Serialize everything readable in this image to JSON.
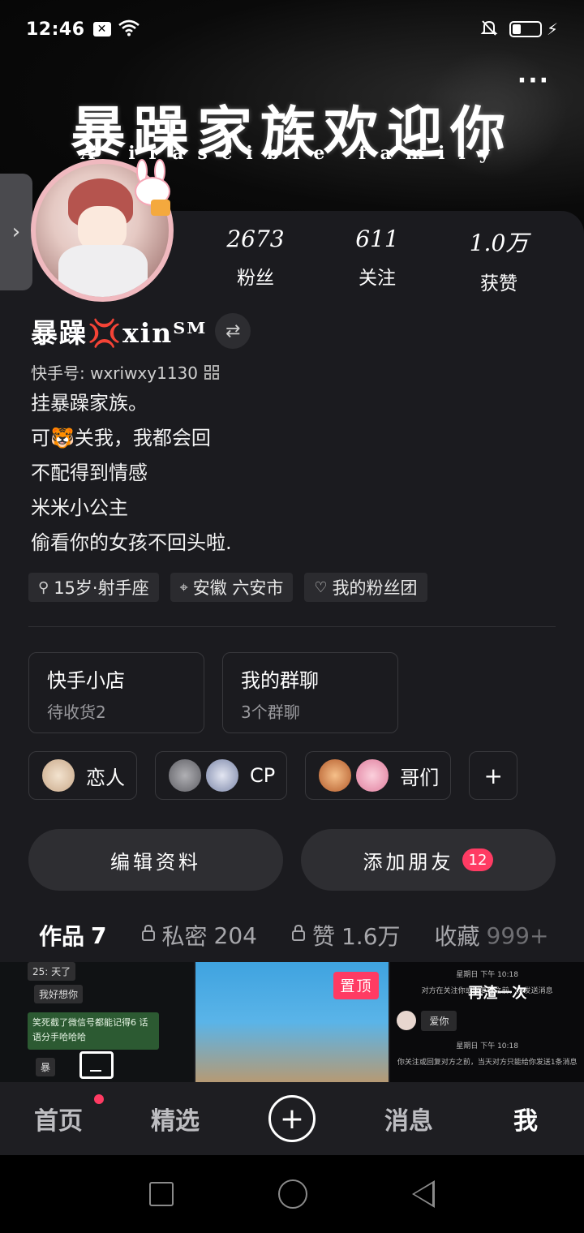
{
  "status_bar": {
    "time": "12:46",
    "notification_icon": "x-box-icon",
    "wifi_icon": "wifi-icon",
    "mute_icon": "bell-off-icon",
    "battery_icon": "battery-charging-icon",
    "battery_level": 0.3
  },
  "header": {
    "title": "暴躁家族欢迎你",
    "subtitle": "A irascible family",
    "more_label": "···"
  },
  "drawer_handle": {
    "icon": "›"
  },
  "stats": [
    {
      "value": "2673",
      "label": "粉丝"
    },
    {
      "value": "611",
      "label": "关注"
    },
    {
      "value": "1.0万",
      "label": "获赞"
    }
  ],
  "profile": {
    "nickname": "暴躁💢xinᵀᴹ",
    "swap_icon": "⇄",
    "kuaishou_id": "快手号: wxriwxy1130",
    "bio_lines": [
      "挂暴躁家族。",
      "可🐯关我，我都会回",
      "不配得到情感",
      "米米小公主",
      "偷看你的女孩不回头啦."
    ],
    "tags": [
      {
        "icon": "⚲",
        "label": "15岁·射手座"
      },
      {
        "icon": "⌖",
        "label": "安徽 六安市"
      },
      {
        "icon": "♡",
        "label": "我的粉丝团"
      }
    ]
  },
  "feature_cards": [
    {
      "title": "快手小店",
      "subtitle": "待收货2"
    },
    {
      "title": "我的群聊",
      "subtitle": "3个群聊"
    }
  ],
  "relations": [
    {
      "label": "恋人",
      "avatars": [
        "#e9d7c4"
      ]
    },
    {
      "label": "CP",
      "avatars": [
        "#8f8f94",
        "#c7cde0"
      ]
    },
    {
      "label": "哥们",
      "avatars": [
        "#e8a16a",
        "#f4b4c6"
      ]
    }
  ],
  "relation_add": "+",
  "actions": {
    "edit_label": "编辑资料",
    "add_friend_label": "添加朋友",
    "add_friend_badge": "12"
  },
  "tabs": [
    {
      "label": "作品",
      "count": "7",
      "locked": false,
      "active": true
    },
    {
      "label": "私密",
      "count": "204",
      "locked": true,
      "active": false
    },
    {
      "label": "赞",
      "count": "1.6万",
      "locked": true,
      "active": false
    },
    {
      "label": "收藏",
      "count": "999+",
      "locked": false,
      "active": false
    }
  ],
  "thumbnails": {
    "t1_lines": [
      "25: 天了",
      "我好想你",
      "笑死截了微信号都能记得6\n话语分手哈哈哈",
      "暴"
    ],
    "t2_pin": "置顶",
    "t3": {
      "time1": "星期日 下午 10:18",
      "notice1": "对方在关注你或回复你之前，你发送消息",
      "overlay": "再渣一次",
      "love": "爱你",
      "time2": "星期日 下午 10:18",
      "notice2": "你关注或回复对方之前，当天对方只能给你发送1条消息"
    }
  },
  "bottom_nav": {
    "home": "首页",
    "featured": "精选",
    "plus": "+",
    "messages": "消息",
    "me": "我"
  },
  "colors": {
    "accent": "#ff3b63",
    "background": "#1b1b1f"
  }
}
